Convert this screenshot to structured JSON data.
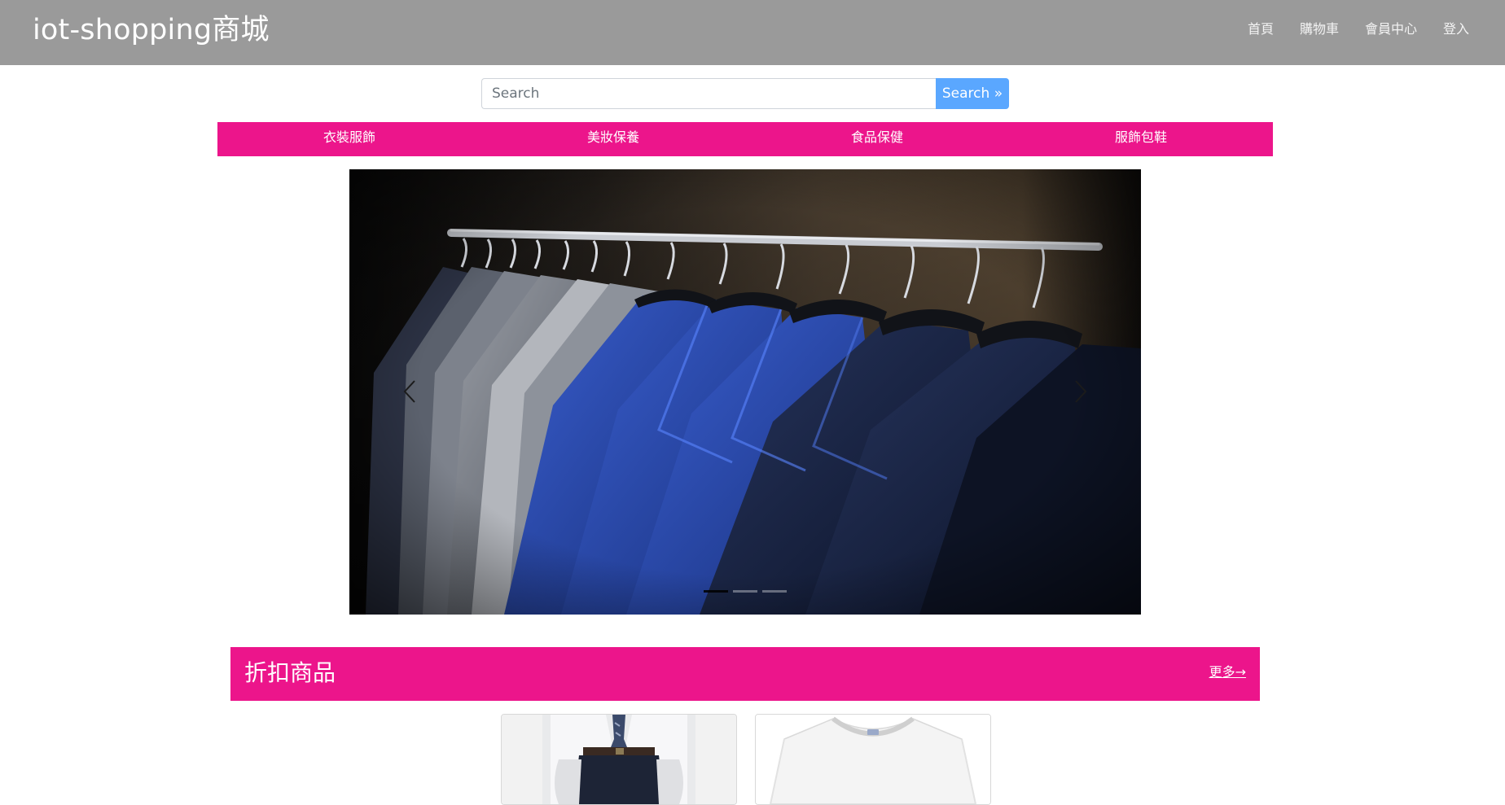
{
  "header": {
    "brand": "iot-shopping商城",
    "nav": [
      "首頁",
      "購物車",
      "會員中心",
      "登入"
    ]
  },
  "search": {
    "placeholder": "Search",
    "value": "",
    "button_label": "Search »"
  },
  "categories": [
    "衣裝服飾",
    "美妝保養",
    "食品保健",
    "服飾包鞋"
  ],
  "carousel": {
    "slide_count": 3,
    "active_index": 0
  },
  "discount_section": {
    "title": "折扣商品",
    "more_label": "更多→"
  },
  "colors": {
    "navbar": "#9a9a9a",
    "accent_pink": "#ec158b",
    "search_button": "#5aa7ff"
  },
  "icons": [
    "chevron-left-icon",
    "chevron-right-icon"
  ]
}
